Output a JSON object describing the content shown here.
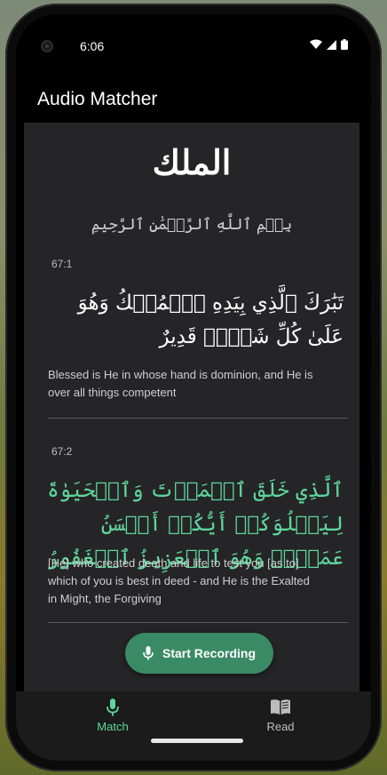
{
  "status_bar": {
    "time": "6:06"
  },
  "app_bar": {
    "title": "Audio Matcher"
  },
  "surah": {
    "title": "الملك",
    "basmala": "بِسۡمِ ٱللَّهِ ٱلرَّحۡمَٰنِ ٱلرَّحِيمِ"
  },
  "verses": [
    {
      "number": "67:1",
      "arabic": "تَبَٰرَكَ ٱلَّذِي بِيَدِهِ ٱلۡمُلۡكُ وَهُوَ عَلَىٰ كُلِّ شَيۡءٖ قَدِيرٌ",
      "translation": "Blessed is He in whose hand is dominion, and He is over all things competent",
      "matched": false
    },
    {
      "number": "67:2",
      "arabic": "ٱلَّذِي خَلَقَ ٱلۡمَوۡتَ وَٱلۡحَيَوٰةَ لِيَبۡلُوَكُمۡ أَيُّكُمۡ أَحۡسَنُ عَمَلٗاۚ وَهُوَ ٱلۡعَزِيزُ ٱلۡغَفُورُ",
      "translation": "[He] who created death and life to test you [as to] which of you is best in deed - and He is the Exalted in Might, the Forgiving",
      "matched": true
    }
  ],
  "record_button": {
    "label": "Start Recording"
  },
  "bottom_nav": {
    "items": [
      {
        "label": "Match",
        "icon": "mic-icon",
        "active": true
      },
      {
        "label": "Read",
        "icon": "book-icon",
        "active": false
      }
    ]
  },
  "colors": {
    "accent": "#5ed69b",
    "button": "#3a8a65",
    "surface": "#252527",
    "nav_inactive": "#bdbdbd"
  }
}
